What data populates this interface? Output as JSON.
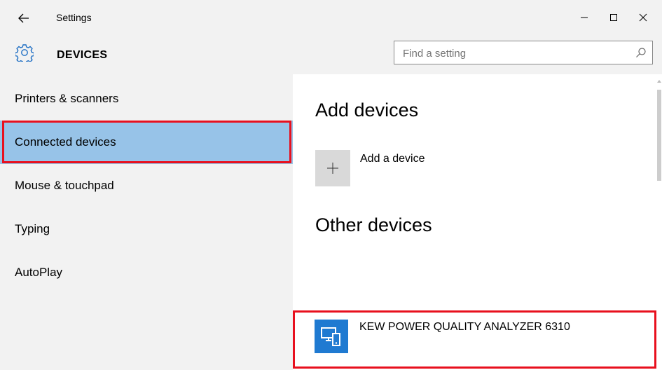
{
  "window": {
    "title": "Settings",
    "controls": [
      "minimize",
      "maximize",
      "close"
    ]
  },
  "header": {
    "title": "DEVICES",
    "icon": "gear-icon"
  },
  "search": {
    "placeholder": "Find a setting",
    "icon": "search-icon"
  },
  "sidebar": {
    "items": [
      {
        "label": "Printers & scanners",
        "selected": false
      },
      {
        "label": "Connected devices",
        "selected": true
      },
      {
        "label": "Mouse & touchpad",
        "selected": false
      },
      {
        "label": "Typing",
        "selected": false
      },
      {
        "label": "AutoPlay",
        "selected": false
      }
    ]
  },
  "main": {
    "add_section_title": "Add devices",
    "add_device_label": "Add a device",
    "other_section_title": "Other devices",
    "devices": [
      {
        "name": "KEW POWER QUALITY ANALYZER 6310",
        "icon": "device-icon"
      }
    ]
  },
  "colors": {
    "chrome_bg": "#f2f2f2",
    "selected_bg": "#97c3e8",
    "highlight_outline": "#e8101e",
    "device_icon_bg": "#1f7ad1",
    "add_tile_bg": "#d9d9d9"
  }
}
